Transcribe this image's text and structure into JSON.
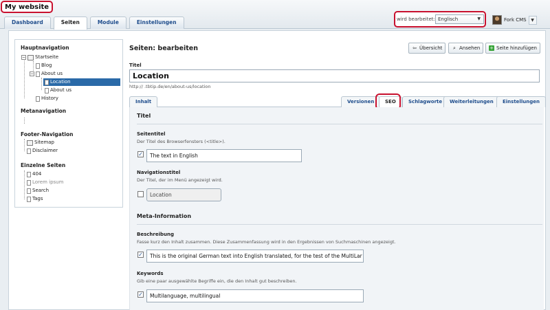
{
  "header": {
    "site_title": "My website",
    "tabs": [
      "Dashboard",
      "Seiten",
      "Module",
      "Einstellungen"
    ],
    "editing_label": "wird bearbeitet:",
    "language": "Englisch",
    "user": "Fork CMS"
  },
  "sidebar": {
    "main_nav_title": "Hauptnavigation",
    "main_nav": [
      "Startseite",
      "Blog",
      "About us",
      "Location",
      "About us",
      "History"
    ],
    "meta_nav_title": "Metanavigation",
    "footer_nav_title": "Footer-Navigation",
    "footer_nav": [
      "Sitemap",
      "Disclaimer"
    ],
    "single_pages_title": "Einzelne Seiten",
    "single_pages": [
      "404",
      "Lorem ipsum",
      "Search",
      "Tags"
    ]
  },
  "main": {
    "heading": "Seiten: bearbeiten",
    "buttons": {
      "overview": "Übersicht",
      "view": "Ansehen",
      "add": "Seite hinzufügen"
    },
    "title_label": "Titel",
    "title_value": "Location",
    "url": "http://            .tbtip.de/en/about-us/location",
    "tabs": [
      "Inhalt",
      "Versionen",
      "SEO",
      "Schlagworte",
      "Weiterleitungen",
      "Einstellungen"
    ],
    "seo": {
      "title_section": "Titel",
      "page_title_label": "Seitentitel",
      "page_title_help": "Der Titel des Browserfensters (<title>).",
      "page_title_value": "The text in English",
      "nav_title_label": "Navigationstitel",
      "nav_title_help": "Der Titel, der im Menü angezeigt wird.",
      "nav_title_value": "Location",
      "meta_section": "Meta-Information",
      "description_label": "Beschreibung",
      "description_help": "Fasse kurz den Inhalt zusammen. Diese Zusammenfassung wird in den Ergebnissen von Suchmaschinen angezeigt.",
      "description_value": "This is the original German text into English translated, for the test of the MultiLar",
      "keywords_label": "Keywords",
      "keywords_help": "Gib eine paar ausgewählte Begriffe ein, die den Inhalt gut beschreiben.",
      "keywords_value": "Multilanguage, multilingual"
    }
  }
}
